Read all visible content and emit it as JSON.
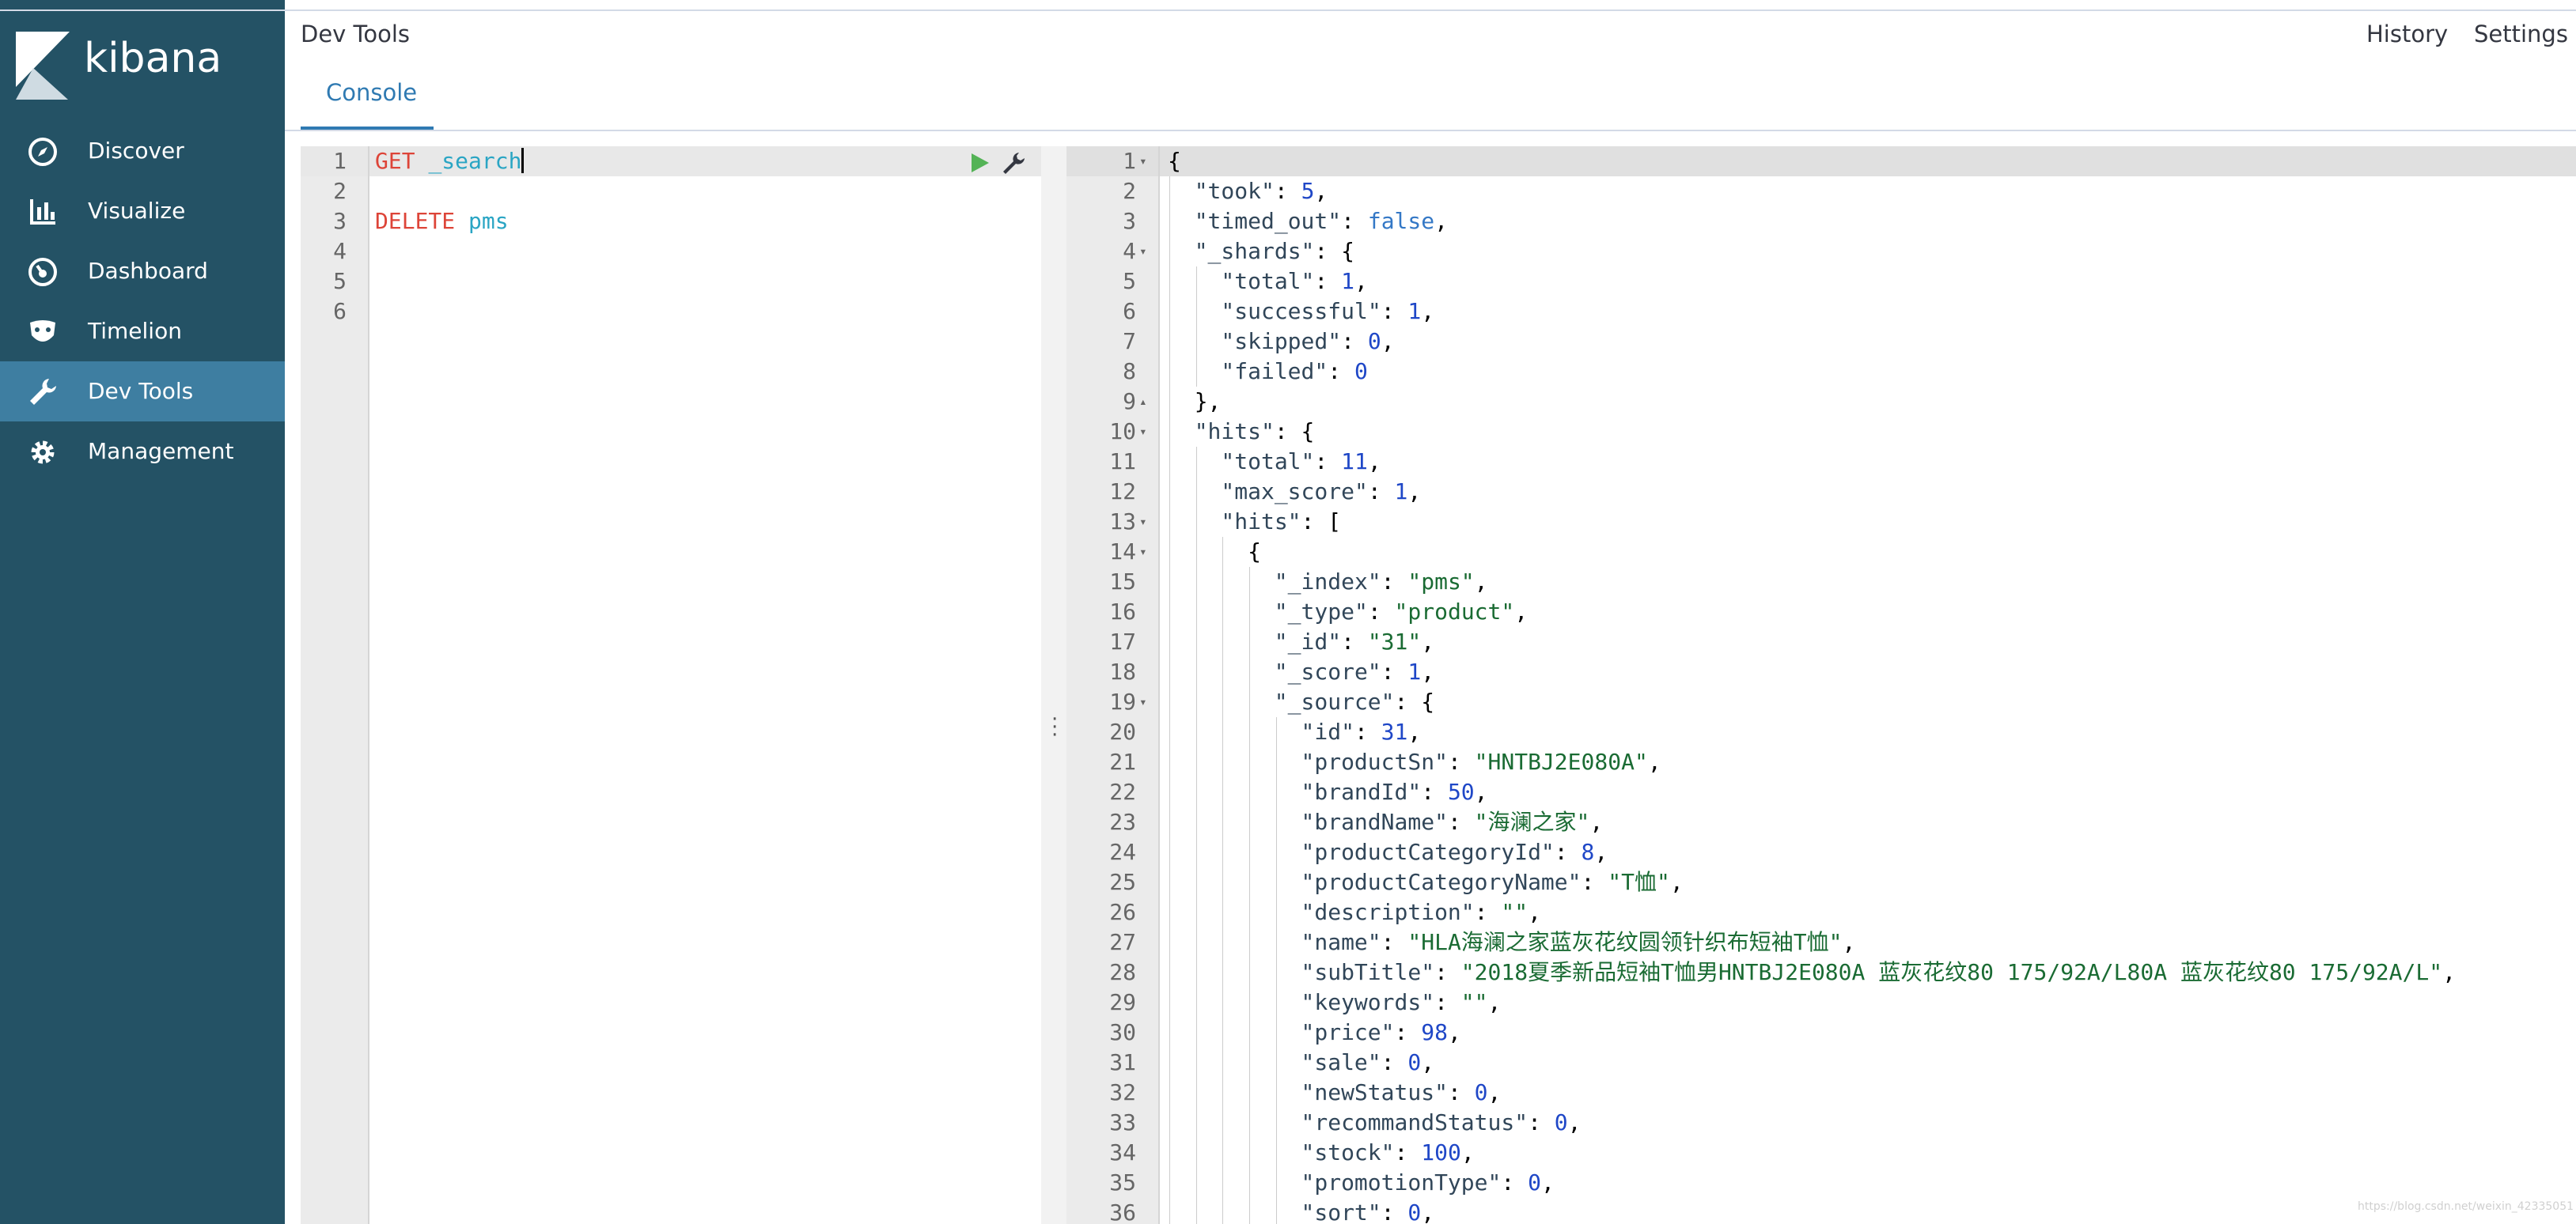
{
  "brand": {
    "name": "kibana",
    "sidebar_bg": "#245265",
    "active_bg": "#3e7ea1"
  },
  "sidebar": {
    "items": [
      {
        "label": "Discover",
        "icon": "compass-icon",
        "active": false
      },
      {
        "label": "Visualize",
        "icon": "bar-chart-icon",
        "active": false
      },
      {
        "label": "Dashboard",
        "icon": "dashboard-gauge-icon",
        "active": false
      },
      {
        "label": "Timelion",
        "icon": "timelion-mask-icon",
        "active": false
      },
      {
        "label": "Dev Tools",
        "icon": "wrench-icon",
        "active": true
      },
      {
        "label": "Management",
        "icon": "gear-icon",
        "active": false
      }
    ]
  },
  "header": {
    "title": "Dev Tools",
    "history": "History",
    "settings": "Settings"
  },
  "tabs": [
    {
      "label": "Console",
      "active": true
    }
  ],
  "input_editor": {
    "lines": [
      {
        "n": "1",
        "method": "GET",
        "url": "_search"
      },
      {
        "n": "2",
        "method": "",
        "url": ""
      },
      {
        "n": "3",
        "method": "DELETE",
        "url": "pms"
      },
      {
        "n": "4",
        "method": "",
        "url": ""
      },
      {
        "n": "5",
        "method": "",
        "url": ""
      },
      {
        "n": "6",
        "method": "",
        "url": ""
      }
    ],
    "run_icon": "play-icon",
    "tools_icon": "wrench-icon"
  },
  "output_editor": {
    "lines": [
      {
        "n": "1",
        "fold": "▾",
        "indent": 0,
        "tokens": [
          [
            "p",
            "{"
          ]
        ]
      },
      {
        "n": "2",
        "fold": "",
        "indent": 1,
        "tokens": [
          [
            "k",
            "\"took\""
          ],
          [
            "p",
            ": "
          ],
          [
            "n",
            "5"
          ],
          [
            "p",
            ","
          ]
        ]
      },
      {
        "n": "3",
        "fold": "",
        "indent": 1,
        "tokens": [
          [
            "k",
            "\"timed_out\""
          ],
          [
            "p",
            ": "
          ],
          [
            "b",
            "false"
          ],
          [
            "p",
            ","
          ]
        ]
      },
      {
        "n": "4",
        "fold": "▾",
        "indent": 1,
        "tokens": [
          [
            "k",
            "\"_shards\""
          ],
          [
            "p",
            ": {"
          ]
        ]
      },
      {
        "n": "5",
        "fold": "",
        "indent": 2,
        "tokens": [
          [
            "k",
            "\"total\""
          ],
          [
            "p",
            ": "
          ],
          [
            "n",
            "1"
          ],
          [
            "p",
            ","
          ]
        ]
      },
      {
        "n": "6",
        "fold": "",
        "indent": 2,
        "tokens": [
          [
            "k",
            "\"successful\""
          ],
          [
            "p",
            ": "
          ],
          [
            "n",
            "1"
          ],
          [
            "p",
            ","
          ]
        ]
      },
      {
        "n": "7",
        "fold": "",
        "indent": 2,
        "tokens": [
          [
            "k",
            "\"skipped\""
          ],
          [
            "p",
            ": "
          ],
          [
            "n",
            "0"
          ],
          [
            "p",
            ","
          ]
        ]
      },
      {
        "n": "8",
        "fold": "",
        "indent": 2,
        "tokens": [
          [
            "k",
            "\"failed\""
          ],
          [
            "p",
            ": "
          ],
          [
            "n",
            "0"
          ]
        ]
      },
      {
        "n": "9",
        "fold": "▴",
        "indent": 1,
        "tokens": [
          [
            "p",
            "},"
          ]
        ]
      },
      {
        "n": "10",
        "fold": "▾",
        "indent": 1,
        "tokens": [
          [
            "k",
            "\"hits\""
          ],
          [
            "p",
            ": {"
          ]
        ]
      },
      {
        "n": "11",
        "fold": "",
        "indent": 2,
        "tokens": [
          [
            "k",
            "\"total\""
          ],
          [
            "p",
            ": "
          ],
          [
            "n",
            "11"
          ],
          [
            "p",
            ","
          ]
        ]
      },
      {
        "n": "12",
        "fold": "",
        "indent": 2,
        "tokens": [
          [
            "k",
            "\"max_score\""
          ],
          [
            "p",
            ": "
          ],
          [
            "n",
            "1"
          ],
          [
            "p",
            ","
          ]
        ]
      },
      {
        "n": "13",
        "fold": "▾",
        "indent": 2,
        "tokens": [
          [
            "k",
            "\"hits\""
          ],
          [
            "p",
            ": ["
          ]
        ]
      },
      {
        "n": "14",
        "fold": "▾",
        "indent": 3,
        "tokens": [
          [
            "p",
            "{"
          ]
        ]
      },
      {
        "n": "15",
        "fold": "",
        "indent": 4,
        "tokens": [
          [
            "k",
            "\"_index\""
          ],
          [
            "p",
            ": "
          ],
          [
            "s",
            "\"pms\""
          ],
          [
            "p",
            ","
          ]
        ]
      },
      {
        "n": "16",
        "fold": "",
        "indent": 4,
        "tokens": [
          [
            "k",
            "\"_type\""
          ],
          [
            "p",
            ": "
          ],
          [
            "s",
            "\"product\""
          ],
          [
            "p",
            ","
          ]
        ]
      },
      {
        "n": "17",
        "fold": "",
        "indent": 4,
        "tokens": [
          [
            "k",
            "\"_id\""
          ],
          [
            "p",
            ": "
          ],
          [
            "s",
            "\"31\""
          ],
          [
            "p",
            ","
          ]
        ]
      },
      {
        "n": "18",
        "fold": "",
        "indent": 4,
        "tokens": [
          [
            "k",
            "\"_score\""
          ],
          [
            "p",
            ": "
          ],
          [
            "n",
            "1"
          ],
          [
            "p",
            ","
          ]
        ]
      },
      {
        "n": "19",
        "fold": "▾",
        "indent": 4,
        "tokens": [
          [
            "k",
            "\"_source\""
          ],
          [
            "p",
            ": {"
          ]
        ]
      },
      {
        "n": "20",
        "fold": "",
        "indent": 5,
        "tokens": [
          [
            "k",
            "\"id\""
          ],
          [
            "p",
            ": "
          ],
          [
            "n",
            "31"
          ],
          [
            "p",
            ","
          ]
        ]
      },
      {
        "n": "21",
        "fold": "",
        "indent": 5,
        "tokens": [
          [
            "k",
            "\"productSn\""
          ],
          [
            "p",
            ": "
          ],
          [
            "s",
            "\"HNTBJ2E080A\""
          ],
          [
            "p",
            ","
          ]
        ]
      },
      {
        "n": "22",
        "fold": "",
        "indent": 5,
        "tokens": [
          [
            "k",
            "\"brandId\""
          ],
          [
            "p",
            ": "
          ],
          [
            "n",
            "50"
          ],
          [
            "p",
            ","
          ]
        ]
      },
      {
        "n": "23",
        "fold": "",
        "indent": 5,
        "tokens": [
          [
            "k",
            "\"brandName\""
          ],
          [
            "p",
            ": "
          ],
          [
            "s",
            "\"海澜之家\""
          ],
          [
            "p",
            ","
          ]
        ]
      },
      {
        "n": "24",
        "fold": "",
        "indent": 5,
        "tokens": [
          [
            "k",
            "\"productCategoryId\""
          ],
          [
            "p",
            ": "
          ],
          [
            "n",
            "8"
          ],
          [
            "p",
            ","
          ]
        ]
      },
      {
        "n": "25",
        "fold": "",
        "indent": 5,
        "tokens": [
          [
            "k",
            "\"productCategoryName\""
          ],
          [
            "p",
            ": "
          ],
          [
            "s",
            "\"T恤\""
          ],
          [
            "p",
            ","
          ]
        ]
      },
      {
        "n": "26",
        "fold": "",
        "indent": 5,
        "tokens": [
          [
            "k",
            "\"description\""
          ],
          [
            "p",
            ": "
          ],
          [
            "s",
            "\"\""
          ],
          [
            "p",
            ","
          ]
        ]
      },
      {
        "n": "27",
        "fold": "",
        "indent": 5,
        "tokens": [
          [
            "k",
            "\"name\""
          ],
          [
            "p",
            ": "
          ],
          [
            "s",
            "\"HLA海澜之家蓝灰花纹圆领针织布短袖T恤\""
          ],
          [
            "p",
            ","
          ]
        ]
      },
      {
        "n": "28",
        "fold": "",
        "indent": 5,
        "tokens": [
          [
            "k",
            "\"subTitle\""
          ],
          [
            "p",
            ": "
          ],
          [
            "s",
            "\"2018夏季新品短袖T恤男HNTBJ2E080A 蓝灰花纹80 175/92A/L80A 蓝灰花纹80 175/92A/L\""
          ],
          [
            "p",
            ","
          ]
        ]
      },
      {
        "n": "29",
        "fold": "",
        "indent": 5,
        "tokens": [
          [
            "k",
            "\"keywords\""
          ],
          [
            "p",
            ": "
          ],
          [
            "s",
            "\"\""
          ],
          [
            "p",
            ","
          ]
        ]
      },
      {
        "n": "30",
        "fold": "",
        "indent": 5,
        "tokens": [
          [
            "k",
            "\"price\""
          ],
          [
            "p",
            ": "
          ],
          [
            "n",
            "98"
          ],
          [
            "p",
            ","
          ]
        ]
      },
      {
        "n": "31",
        "fold": "",
        "indent": 5,
        "tokens": [
          [
            "k",
            "\"sale\""
          ],
          [
            "p",
            ": "
          ],
          [
            "n",
            "0"
          ],
          [
            "p",
            ","
          ]
        ]
      },
      {
        "n": "32",
        "fold": "",
        "indent": 5,
        "tokens": [
          [
            "k",
            "\"newStatus\""
          ],
          [
            "p",
            ": "
          ],
          [
            "n",
            "0"
          ],
          [
            "p",
            ","
          ]
        ]
      },
      {
        "n": "33",
        "fold": "",
        "indent": 5,
        "tokens": [
          [
            "k",
            "\"recommandStatus\""
          ],
          [
            "p",
            ": "
          ],
          [
            "n",
            "0"
          ],
          [
            "p",
            ","
          ]
        ]
      },
      {
        "n": "34",
        "fold": "",
        "indent": 5,
        "tokens": [
          [
            "k",
            "\"stock\""
          ],
          [
            "p",
            ": "
          ],
          [
            "n",
            "100"
          ],
          [
            "p",
            ","
          ]
        ]
      },
      {
        "n": "35",
        "fold": "",
        "indent": 5,
        "tokens": [
          [
            "k",
            "\"promotionType\""
          ],
          [
            "p",
            ": "
          ],
          [
            "n",
            "0"
          ],
          [
            "p",
            ","
          ]
        ]
      },
      {
        "n": "36",
        "fold": "",
        "indent": 5,
        "tokens": [
          [
            "k",
            "\"sort\""
          ],
          [
            "p",
            ": "
          ],
          [
            "n",
            "0"
          ],
          [
            "p",
            ","
          ]
        ]
      }
    ]
  },
  "watermark": "https://blog.csdn.net/weixin_42335051"
}
